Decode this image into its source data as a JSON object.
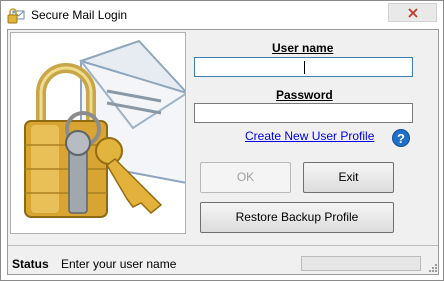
{
  "window": {
    "title": "Secure Mail Login"
  },
  "form": {
    "username_label": "User name",
    "username_value": "",
    "password_label": "Password",
    "password_value": "",
    "create_profile_link": "Create New User Profile"
  },
  "buttons": {
    "ok_label": "OK",
    "exit_label": "Exit",
    "restore_label": "Restore Backup Profile"
  },
  "status": {
    "label": "Status",
    "text": "Enter your user name",
    "progress": 0
  },
  "icons": {
    "app": "padlock-mail-icon",
    "help": "help-icon",
    "close": "close-icon",
    "illustration": "padlock-keys-envelope-icon"
  },
  "colors": {
    "link": "#0000ee",
    "help": "#1f6fc8",
    "close_x": "#c0392b"
  }
}
